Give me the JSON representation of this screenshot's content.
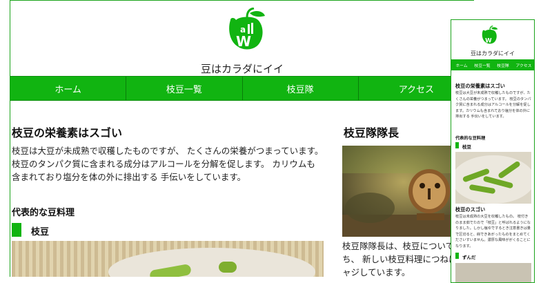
{
  "desktop": {
    "site_title": "豆はカラダにイイ",
    "logo_text": "all W",
    "nav": [
      "ホーム",
      "枝豆一覧",
      "枝豆隊",
      "アクセス"
    ],
    "main": {
      "heading": "枝豆の栄養素はスゴい",
      "paragraph": "枝豆は大豆が未成熟で収穫したものですが、 たくさんの栄養がつまっています。 枝豆のタンパク質に含まれる成分はアルコールを分解を促します。 カリウムも含まれており塩分を体の外に排出する 手伝いをしています。",
      "section_title": "代表的な豆料理",
      "subheading": "枝豆"
    },
    "sidebar": {
      "heading": "枝豆隊隊長",
      "paragraph": "枝豆隊隊長は、枝豆について知ち、 新しい枝豆料理につねにチャジしています。"
    }
  },
  "mobile": {
    "site_title": "豆はカラダにイイ",
    "nav": [
      "ホーム",
      "枝豆一覧",
      "枝豆隊",
      "アクセス"
    ],
    "heading": "枝豆の栄養素はスゴい",
    "paragraph": "枝豆は大豆が未成熟で収穫したものですが、たくさんの栄養がつまっています。 枝豆のタンパク質に含まれる成分はアルコールを分解を促します。カリウムも含まれており塩分を体の外に排出する 手伝いをしています。",
    "section_title": "代表的な豆料理",
    "sub1": "枝豆",
    "heading2": "枝豆のスゴい",
    "paragraph2": "枝豆は未成熟の大豆を収穫したもの。 枝付きのまま茹でたので「枝豆」と呼ばれるようになりました。しかし塩ゆでするとき注意書きは量で区切ると、冊できあがったものをまとめてくださいすいません。濃厚な風味ががくることになります。",
    "sub2": "ずんだ"
  }
}
